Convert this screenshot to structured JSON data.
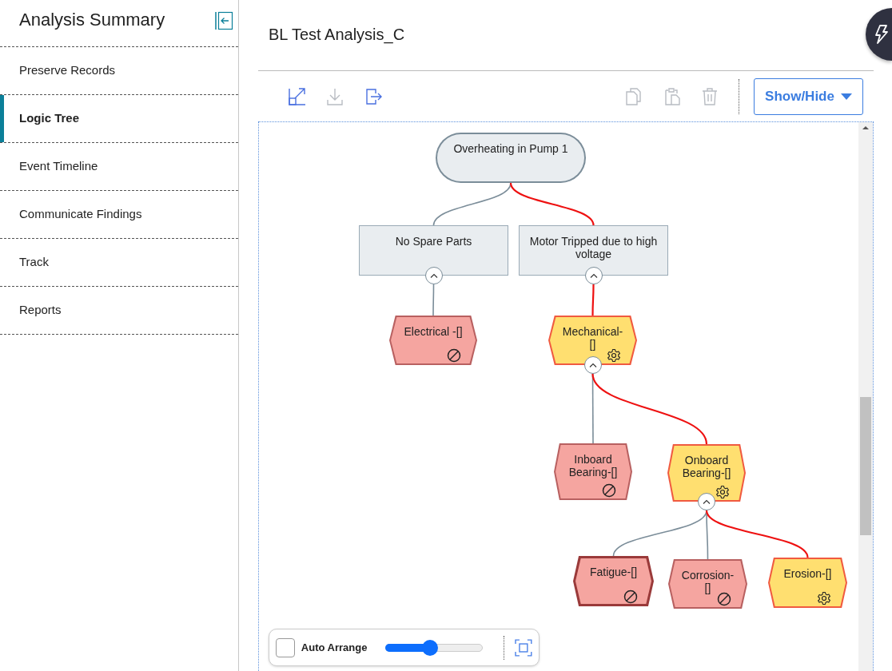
{
  "sidebar": {
    "title": "Analysis Summary",
    "items": [
      {
        "label": "Preserve Records",
        "selected": false
      },
      {
        "label": "Logic Tree",
        "selected": true
      },
      {
        "label": "Event Timeline",
        "selected": false
      },
      {
        "label": "Communicate Findings",
        "selected": false
      },
      {
        "label": "Track",
        "selected": false
      },
      {
        "label": "Reports",
        "selected": false
      }
    ]
  },
  "header": {
    "title": "BL Test Analysis_C"
  },
  "toolbar": {
    "tools": [
      {
        "kind": "expand",
        "disabled": false
      },
      {
        "kind": "download",
        "disabled": true
      },
      {
        "kind": "export",
        "disabled": false
      },
      {
        "kind": "copy",
        "disabled": true
      },
      {
        "kind": "paste",
        "disabled": true
      },
      {
        "kind": "delete",
        "disabled": true
      }
    ],
    "show_hide_label": "Show/Hide"
  },
  "tree": {
    "label": "Overheating in Pump 1",
    "kind": "root",
    "selected": false,
    "children": [
      {
        "label": "No Spare Parts",
        "kind": "event",
        "selected": false,
        "on_path": false,
        "expanded": true,
        "children": [
          {
            "label": "Electrical -[]",
            "kind": "hypothesis",
            "ruled_out": true,
            "selected": false,
            "on_path": false
          }
        ]
      },
      {
        "label": "Motor Tripped due to high voltage",
        "kind": "event",
        "selected": false,
        "on_path": true,
        "expanded": true,
        "children": [
          {
            "label": "Mechanical-[]",
            "kind": "hypothesis",
            "ruled_out": false,
            "selected": false,
            "on_path": true,
            "expanded": true,
            "children": [
              {
                "label": "Inboard Bearing-[]",
                "kind": "hypothesis",
                "ruled_out": true,
                "selected": false,
                "on_path": false
              },
              {
                "label": "Onboard Bearing-[]",
                "kind": "hypothesis",
                "ruled_out": false,
                "selected": false,
                "on_path": true,
                "expanded": true,
                "children": [
                  {
                    "label": "Fatigue-[]",
                    "kind": "hypothesis",
                    "ruled_out": true,
                    "selected": true,
                    "on_path": false
                  },
                  {
                    "label": "Corrosion-[]",
                    "kind": "hypothesis",
                    "ruled_out": true,
                    "selected": false,
                    "on_path": false
                  },
                  {
                    "label": "Erosion-[]",
                    "kind": "hypothesis",
                    "ruled_out": false,
                    "selected": false,
                    "on_path": true
                  }
                ]
              }
            ]
          }
        ]
      }
    ]
  },
  "controls": {
    "auto_arrange": {
      "label": "Auto Arrange",
      "checked": false
    },
    "zoom": {
      "level": 0.46
    }
  }
}
